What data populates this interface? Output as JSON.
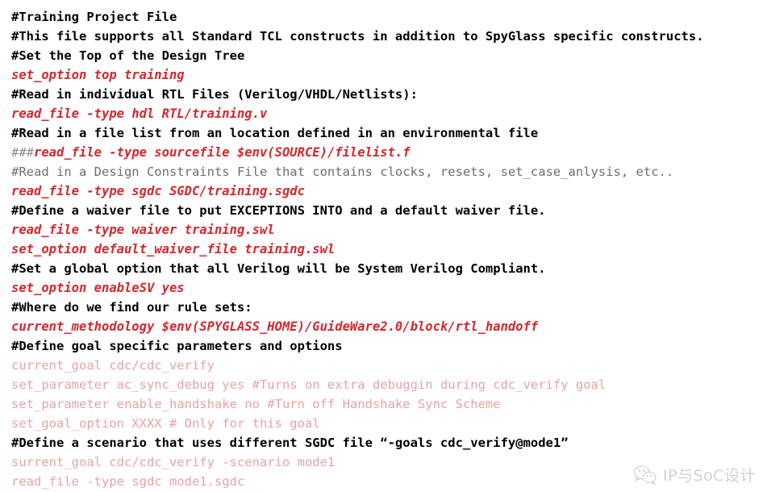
{
  "document": {
    "title": "Training Project File",
    "language": "tcl",
    "colors": {
      "background": "#ffffff",
      "comment": "#000000",
      "comment_faded": "#6e6e6e",
      "command": "#d8262c",
      "command_faded": "#e8a3a3",
      "hash_prefix": "#8c8c8c"
    }
  },
  "lines": [
    {
      "n": 1,
      "style": "comment",
      "text": "#Training Project File"
    },
    {
      "n": 2,
      "style": "comment",
      "text": "#This file supports all Standard TCL constructs in addition to SpyGlass specific constructs."
    },
    {
      "n": 3,
      "style": "comment",
      "text": "#Set the Top of the Design Tree"
    },
    {
      "n": 4,
      "style": "cmd",
      "text": "set_option top training"
    },
    {
      "n": 5,
      "style": "comment",
      "text": "#Read in individual RTL Files (Verilog/VHDL/Netlists):"
    },
    {
      "n": 6,
      "style": "cmd",
      "text": "read_file -type hdl RTL/training.v"
    },
    {
      "n": 7,
      "style": "comment",
      "text": "#Read in a file list from an location defined in an environmental file"
    },
    {
      "n": 8,
      "style": "cmd-prefixed",
      "prefix": "###",
      "text": "read_file -type sourcefile $env(SOURCE)/filelist.f"
    },
    {
      "n": 9,
      "style": "comment-grey",
      "text": "#Read in a Design Constraints File that contains clocks, resets, set_case_anlysis, etc.."
    },
    {
      "n": 10,
      "style": "cmd",
      "text": "read_file -type sgdc SGDC/training.sgdc"
    },
    {
      "n": 11,
      "style": "comment",
      "text": "#Define a waiver file to put EXCEPTIONS INTO and a default waiver file."
    },
    {
      "n": 12,
      "style": "cmd",
      "text": "read_file -type waiver training.swl"
    },
    {
      "n": 13,
      "style": "cmd",
      "text": "set_option default_waiver_file training.swl"
    },
    {
      "n": 14,
      "style": "comment",
      "text": "#Set a global option that all Verilog will be System Verilog Compliant."
    },
    {
      "n": 15,
      "style": "cmd",
      "text": "set_option enableSV yes"
    },
    {
      "n": 16,
      "style": "comment",
      "text": "#Where do we find our rule sets:"
    },
    {
      "n": 17,
      "style": "cmd",
      "text": "current_methodology $env(SPYGLASS_HOME)/GuideWare2.0/block/rtl_handoff"
    },
    {
      "n": 18,
      "style": "comment",
      "text": "#Define goal specific parameters and options"
    },
    {
      "n": 19,
      "style": "cmd-faded",
      "text": "current_goal cdc/cdc_verify"
    },
    {
      "n": 20,
      "style": "cmd-faded",
      "text": "set_parameter ac_sync_debug yes #Turns on extra debuggin during cdc_verify goal"
    },
    {
      "n": 21,
      "style": "cmd-faded",
      "text": "set_parameter enable_handshake no #Turn off Handshake Sync Scheme"
    },
    {
      "n": 22,
      "style": "cmd-faded",
      "text": "set_goal_option XXXX # Only for this goal"
    },
    {
      "n": 23,
      "style": "comment",
      "text": "#Define a scenario that uses different SGDC file “-goals cdc_verify@mode1”"
    },
    {
      "n": 24,
      "style": "cmd-faded",
      "text": "surrent_goal cdc/cdc_verify -scenario mode1"
    },
    {
      "n": 25,
      "style": "cmd-faded",
      "text": "read_file -type sgdc mode1.sgdc"
    }
  ],
  "watermark": {
    "icon": "wechat-icon",
    "text": "IP与SoC设计"
  }
}
